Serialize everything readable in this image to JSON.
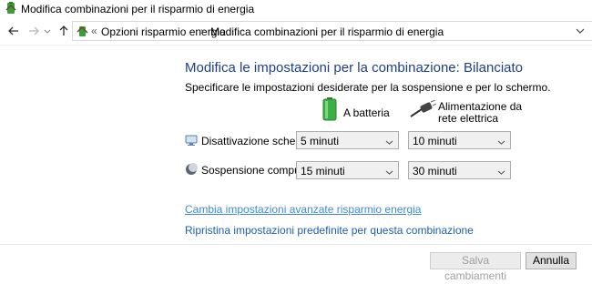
{
  "window": {
    "title": "Modifica combinazioni per il risparmio di energia"
  },
  "breadcrumb": {
    "overflow": "«",
    "items": [
      "Opzioni risparmio energia",
      "Modifica combinazioni per il risparmio di energia"
    ],
    "separator": "›"
  },
  "main": {
    "title": "Modifica le impostazioni per la combinazione: Bilanciato",
    "description": "Specificare le impostazioni desiderate per la sospensione e per lo schermo.",
    "columns": {
      "battery": "A batteria",
      "plugged_line1": "Alimentazione da",
      "plugged_line2": "rete elettrica"
    },
    "rows": [
      {
        "label": "Disattivazione schermo:",
        "battery_value": "5 minuti",
        "plugged_value": "10 minuti"
      },
      {
        "label": "Sospensione computer:",
        "battery_value": "15 minuti",
        "plugged_value": "30 minuti"
      }
    ],
    "links": {
      "advanced": "Cambia impostazioni avanzate risparmio energia",
      "restore": "Ripristina impostazioni predefinite per questa combinazione"
    }
  },
  "footer": {
    "save": "Salva cambiamenti",
    "cancel": "Annulla"
  },
  "colors": {
    "title_blue": "#1e3f8a",
    "link_blue": "#1a5fb4",
    "battery_green": "#3cb043"
  },
  "icons": [
    "power-options-icon",
    "back-arrow-icon",
    "forward-arrow-icon",
    "up-arrow-icon",
    "battery-icon",
    "power-plug-icon",
    "monitor-icon",
    "moon-icon",
    "chevron-down-icon"
  ]
}
